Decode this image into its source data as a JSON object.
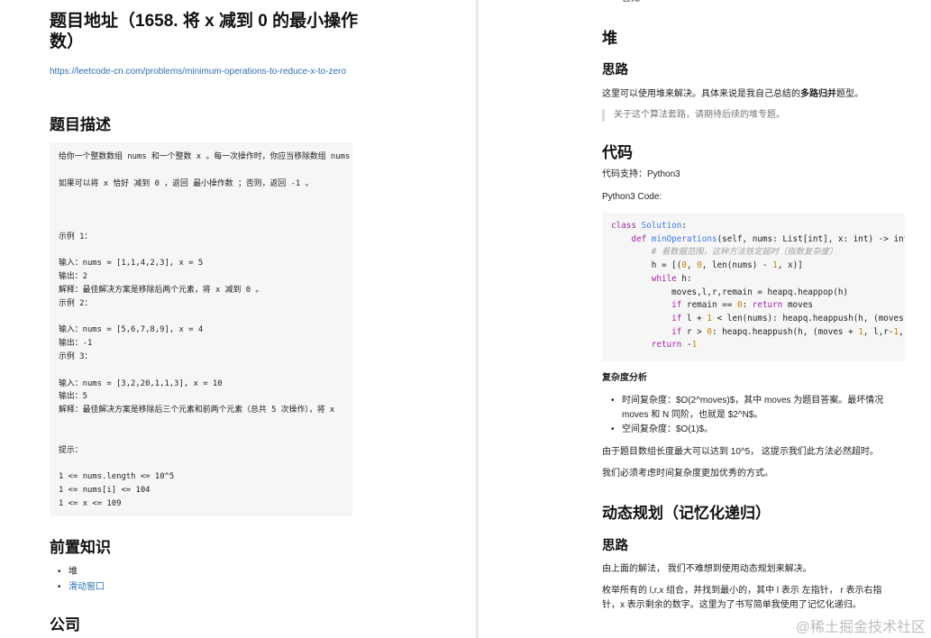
{
  "left": {
    "title": "题目地址（1658. 将 x 减到 0 的最小操作数）",
    "url": "https://leetcode-cn.com/problems/minimum-operations-to-reduce-x-to-zero",
    "desc_heading": "题目描述",
    "description_lines": [
      "给你一个整数数组 nums 和一个整数 x 。每一次操作时，你应当移除数组 nums",
      "",
      "如果可以将 x 恰好 减到 0 ，返回 最小操作数 ；否则，返回 -1 。",
      "",
      "",
      "",
      "示例 1：",
      "",
      "输入：nums = [1,1,4,2,3], x = 5",
      "输出：2",
      "解释：最佳解决方案是移除后两个元素，将 x 减到 0 。",
      "示例 2：",
      "",
      "输入：nums = [5,6,7,8,9], x = 4",
      "输出：-1",
      "示例 3：",
      "",
      "输入：nums = [3,2,20,1,1,3], x = 10",
      "输出：5",
      "解释：最佳解决方案是移除后三个元素和前两个元素（总共 5 次操作），将 x",
      "",
      "",
      "提示：",
      "",
      "1 <= nums.length <= 10^5",
      "1 <= nums[i] <= 104",
      "1 <= x <= 109"
    ],
    "prereq_heading": "前置知识",
    "prereq_items": [
      "堆",
      "滑动窗口"
    ],
    "company_heading": "公司"
  },
  "right": {
    "top_item": "暂无",
    "heap_heading": "堆",
    "idea_heading": "思路",
    "idea_text_before": "这里可以使用堆来解决。具体来说是我自己总结的",
    "idea_text_bold": "多路归并",
    "idea_text_after": "题型。",
    "quote": "关于这个算法套路，请期待后续的堆专题。",
    "code_heading": "代码",
    "code_support": "代码支持：Python3",
    "code_label": "Python3 Code:",
    "code_lines": [
      "class Solution:",
      "    def minOperations(self, nums: List[int], x: int) -> int:",
      "        # 看数据范围，这种方法铁定超时（指数复杂度）",
      "        h = [(0, 0, len(nums) - 1, x)]",
      "        while h:",
      "            moves,l,r,remain = heapq.heappop(h)",
      "            if remain == 0: return moves",
      "            if l + 1 < len(nums): heapq.heappush(h, (moves",
      "            if r > 0: heapq.heappush(h, (moves + 1, l,r-1,",
      "        return -1"
    ],
    "complexity_heading": "复杂度分析",
    "complexity_items": [
      "时间复杂度：$O(2^moves)$，其中 moves 为题目答案。最坏情况 moves 和 N 同阶，也就是 $2^N$。",
      "空间复杂度：$O(1)$。"
    ],
    "para1": "由于题目数组长度最大可以达到 10^5， 这提示我们此方法必然超时。",
    "para2": "我们必须考虑时间复杂度更加优秀的方式。",
    "dp_heading": "动态规划（记忆化递归）",
    "dp_idea_heading": "思路",
    "dp_para1": "由上面的解法， 我们不难想到使用动态规划来解决。",
    "dp_para2": "枚举所有的 l,r,x 组合，并找到最小的，其中 l 表示 左指针， r 表示右指针，x 表示剩余的数字。这里为了书写简单我使用了记忆化递归。"
  },
  "watermark": "@稀土掘金技术社区"
}
